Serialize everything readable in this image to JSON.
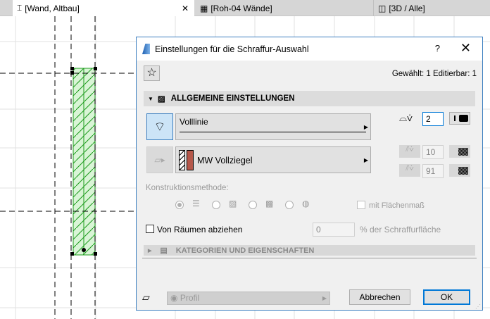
{
  "tabs": [
    {
      "label": "[Wand, Altbau]",
      "icon": "wall-icon",
      "active": true
    },
    {
      "label": "[Roh-04 Wände]",
      "icon": "floorplan-grid-icon"
    },
    {
      "label": "[3D / Alle]",
      "icon": "3d-box-icon"
    }
  ],
  "dialog": {
    "title": "Einstellungen für die Schraffur-Auswahl",
    "help": "?",
    "close": "✕",
    "selection_info": "Gewählt: 1 Editierbar: 1",
    "section_general": "ALLGEMEINE EINSTELLUNGEN",
    "line_type": "Volllinie",
    "contour_pen": "2",
    "fill_name": "MW Vollziegel",
    "fill_color": "#b5574a",
    "fg_pen": "10",
    "bg_pen": "91",
    "construction_label": "Konstruktionsmethode:",
    "area_text_label": "mit Flächenmaß",
    "subtract_label": "Von Räumen abziehen",
    "percent_value": "0",
    "percent_label": "% der Schraffurfläche",
    "section_categories": "KATEGORIEN UND EIGENSCHAFTEN",
    "profile": "Profil",
    "cancel": "Abbrechen",
    "ok": "OK"
  },
  "colors": {
    "accent": "#0078d7",
    "wall_fill": "#d9f5d6",
    "wall_stroke": "#1a9a1a"
  }
}
